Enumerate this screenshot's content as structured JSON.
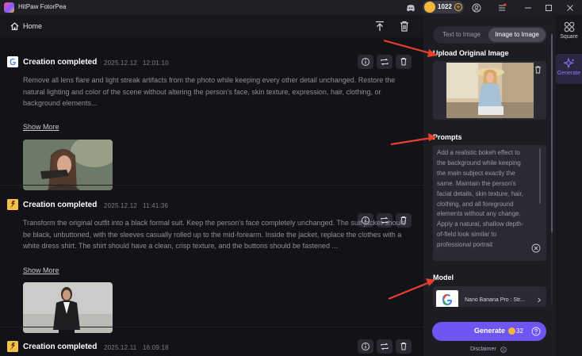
{
  "app": {
    "title": "HitPaw FotorPea",
    "credits": "1022"
  },
  "header": {
    "home_label": "Home"
  },
  "feed": [
    {
      "title": "Creation completed",
      "date": "2025.12.12",
      "time": "12:01:10",
      "logo": "google-logo-icon",
      "description": "Remove all lens flare and light streak artifacts from the photo while keeping every other detail unchanged. Restore the natural lighting and color of the scene without altering the person's face, skin texture, expression, hair, clothing, or background elements...",
      "show_more": "Show More"
    },
    {
      "title": "Creation completed",
      "date": "2025.12.12",
      "time": "11:41:36",
      "logo": "fotorpea-logo-icon",
      "description": "Transform the original outfit into a black formal suit. Keep the person's face completely unchanged. The suit jacket should be black, unbuttoned, with the sleeves casually rolled up to the mid-forearm. Inside the jacket, replace the clothes with a white dress shirt. The shirt should have a clean, crisp texture, and the buttons should be fastened ...",
      "show_more": "Show More"
    },
    {
      "title": "Creation completed",
      "date": "2025.12.11",
      "time": "16:09:18",
      "logo": "fotorpea-logo-icon"
    }
  ],
  "panel": {
    "tabs": [
      {
        "label": "Text to Image",
        "active": false
      },
      {
        "label": "Image to Image",
        "active": true
      }
    ],
    "upload_title": "Upload Original Image",
    "prompts_title": "Prompts",
    "prompt_text": "Add a realistic bokeh effect to the background while keeping the main subject exactly the same. Maintain the person's facial details, skin texture, hair, clothing, and all foreground elements without any change. Apply a natural, shallow depth-of-field look similar to professional portrait photography, with smooth, circular bokeh highlights and soft background blur",
    "model_title": "Model",
    "model_name": "Nano Banana Pro : Str...",
    "generate_label": "Generate",
    "generate_cost": "32",
    "disclaimer": "Disclaimer"
  },
  "sidebar": [
    {
      "label": "Square",
      "icon": "square-grid-icon",
      "active": false
    },
    {
      "label": "Generate",
      "icon": "sparkle-icon",
      "active": true
    }
  ],
  "colors": {
    "accent": "#7155f3",
    "annotation_arrow": "#e8402f",
    "coin": "#f1b63a"
  }
}
